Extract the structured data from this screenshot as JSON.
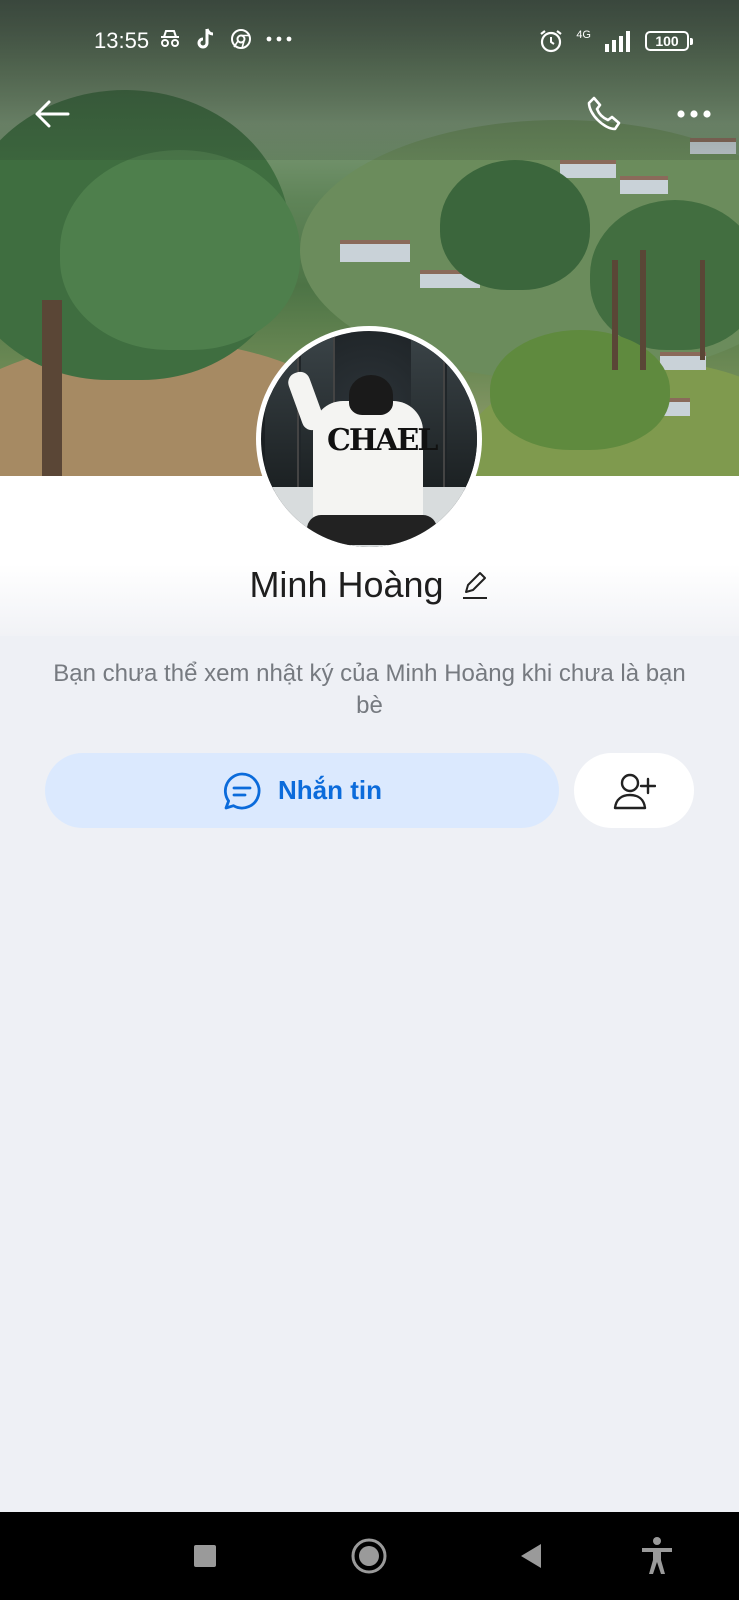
{
  "status_bar": {
    "time": "13:55",
    "network": "4G",
    "battery": "100",
    "left_icons": [
      "incognito-icon",
      "tiktok-icon",
      "chrome-icon",
      "more-dots-icon"
    ],
    "right_icons": [
      "alarm-icon",
      "signal-icon",
      "battery-icon"
    ]
  },
  "header": {
    "icons": [
      "back-arrow-icon",
      "phone-icon",
      "more-horizontal-icon"
    ]
  },
  "profile": {
    "name": "Minh Hoàng",
    "notice": "Bạn chưa thể xem nhật ký của Minh Hoàng khi chưa là bạn bè"
  },
  "actions": {
    "message_label": "Nhắn tin",
    "message_icon": "chat-bubble-icon",
    "add_friend_icon": "add-friend-icon"
  },
  "colors": {
    "accent": "#0b6bdb",
    "message_button_bg": "#dbe9fe",
    "page_bg": "#eef0f5"
  },
  "nav_bar": {
    "icons": [
      "recents-square-icon",
      "home-circle-icon",
      "back-triangle-icon",
      "accessibility-icon"
    ]
  }
}
